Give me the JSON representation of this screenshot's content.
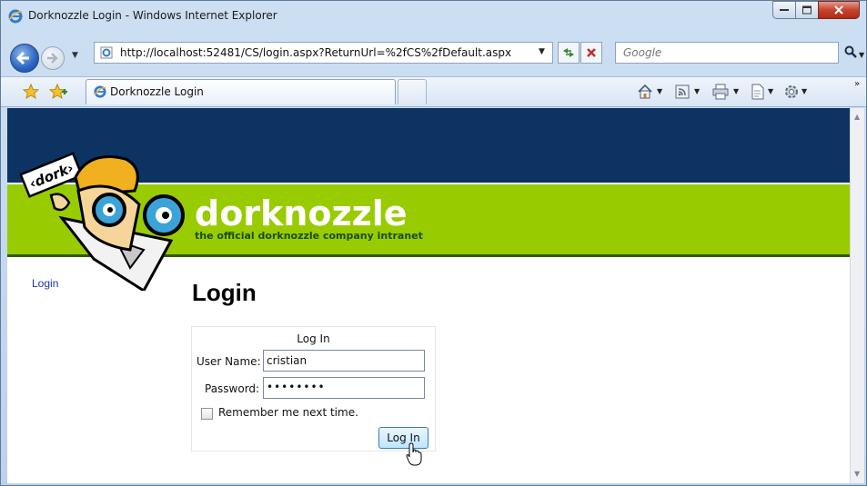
{
  "window": {
    "title": "Dorknozzle Login - Windows Internet Explorer"
  },
  "navigation": {
    "address": "http://localhost:52481/CS/login.aspx?ReturnUrl=%2fCS%2fDefault.aspx",
    "search_placeholder": "Google"
  },
  "tabs": [
    {
      "label": "Dorknozzle Login"
    }
  ],
  "page": {
    "site_name": "dorknozzle",
    "site_tagline": "the official dorknozzle company intranet",
    "logo_sign_text": "‹dork›",
    "sidebar_link": "Login",
    "title": "Login",
    "login_form": {
      "caption": "Log In",
      "username_label": "User Name:",
      "username_value": "cristian",
      "password_label": "Password:",
      "password_masked": "••••••••",
      "remember_label": "Remember me next time.",
      "remember_checked": false,
      "submit_label": "Log In"
    }
  },
  "colors": {
    "header_navy": "#0d3362",
    "header_green": "#99cc00",
    "link": "#1a33aa"
  },
  "icons": {
    "browser": "ie-logo-icon",
    "back": "back-arrow-icon",
    "forward": "forward-arrow-icon",
    "refresh": "refresh-icon",
    "stop": "stop-icon",
    "search": "search-icon",
    "favorites": "favorites-star-icon",
    "add_favorites": "add-favorites-icon",
    "home": "home-icon",
    "feeds": "rss-feed-icon",
    "print": "print-icon",
    "page": "page-icon",
    "tools": "tools-gear-icon"
  }
}
